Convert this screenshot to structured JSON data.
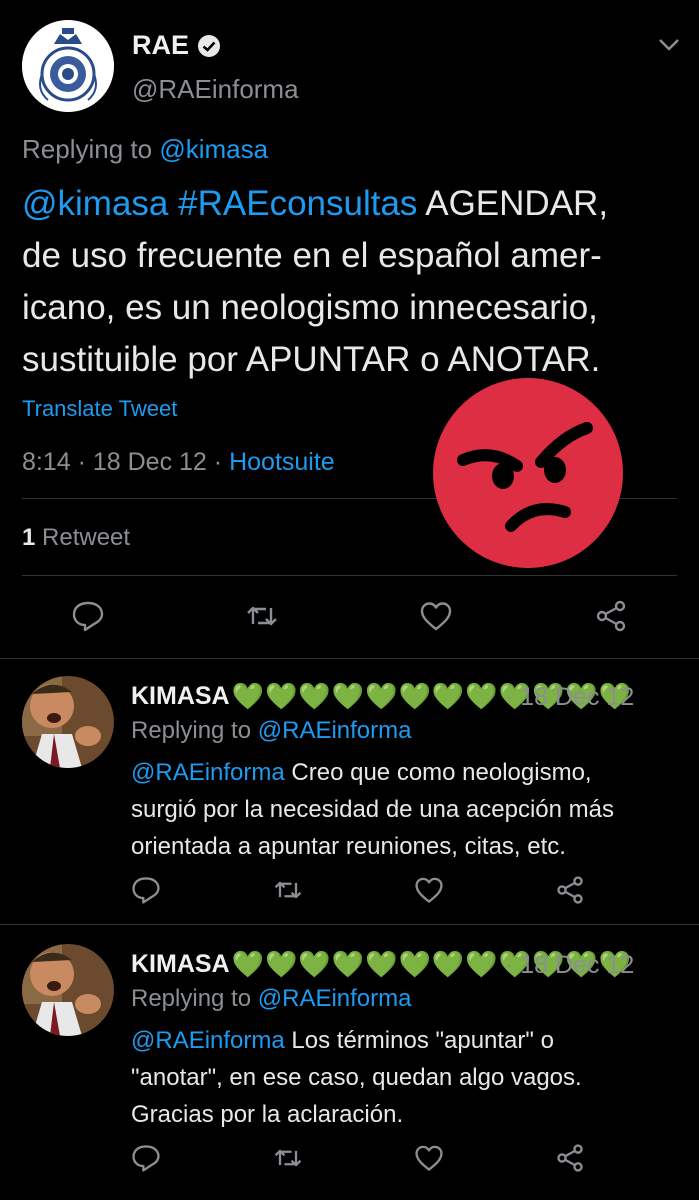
{
  "main_tweet": {
    "author_name": "RAE",
    "handle": "@RAEinforma",
    "replying_label": "Replying to",
    "replying_to": "@kimasa",
    "text_mention": "@kimasa",
    "text_hashtag": "#RAEconsultas",
    "text_line1_rest": "AGENDAR,",
    "text_line2": "de uso frecuente en el español amer-",
    "text_line3": "icano, es un neologismo innecesario,",
    "text_line4": "sustituible por APUNTAR o ANOTAR.",
    "translate_label": "Translate Tweet",
    "time_date": "8:14 · 18 Dec 12 ·",
    "source": "Hootsuite",
    "retweet_count": "1",
    "retweet_label": "Retweet"
  },
  "replies": [
    {
      "author_name": "KIMASA",
      "hearts": "💚💚💚💚💚💚💚💚💚💚💚💚",
      "date": "· 18 Dec 12",
      "replying_label": "Replying to",
      "replying_to": "@RAEinforma",
      "mention": "@RAEinforma",
      "text_line1": "Creo que como neologismo,",
      "text_line2": "surgió por la necesidad de una acepción más",
      "text_line3": "orientada a apuntar reuniones, citas, etc."
    },
    {
      "author_name": "KIMASA",
      "hearts": "💚💚💚💚💚💚💚💚💚💚💚💚",
      "date": "· 18 Dec 12",
      "replying_label": "Replying to",
      "replying_to": "@RAEinforma",
      "mention": "@RAEinforma",
      "text_line1": "Los términos \"apuntar\" o",
      "text_line2": "\"anotar\", en ese caso, quedan algo vagos.",
      "text_line3": "Gracias por la aclaración."
    }
  ],
  "icons": [
    "verified-icon",
    "chevron-down-icon",
    "reply-icon",
    "retweet-icon",
    "like-icon",
    "share-icon",
    "angry-face-emoji"
  ],
  "colors": {
    "background": "#000000",
    "link": "#1d9bf0",
    "muted": "#8b8f94",
    "emoji_red": "#dd2e44",
    "heart_green": "#77c15a"
  }
}
